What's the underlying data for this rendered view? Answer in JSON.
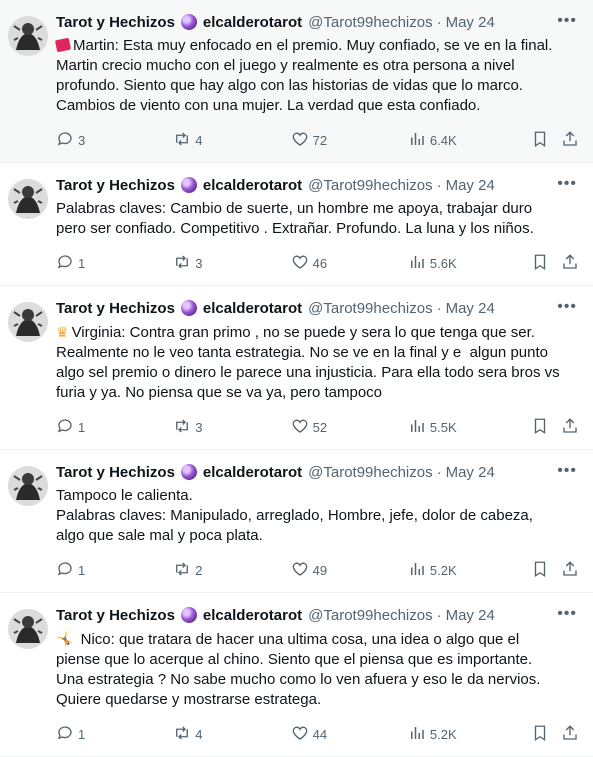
{
  "tweets": [
    {
      "display_name": "Tarot y Hechizos",
      "username": "elcalderotarot",
      "handle": "@Tarot99hechizos",
      "date": "May 24",
      "emoji": "ticket-icon",
      "text": "Martin: Esta muy enfocado en el premio. Muy confiado, se ve en la final.\nMartin crecio mucho con el juego y realmente es otra persona a nivel\nprofundo. Siento que hay algo con las historias de vidas que lo marco.\nCambios de viento con una mujer. La verdad que esta confiado.",
      "replies": "3",
      "retweets": "4",
      "likes": "72",
      "views": "6.4K"
    },
    {
      "display_name": "Tarot y Hechizos",
      "username": "elcalderotarot",
      "handle": "@Tarot99hechizos",
      "date": "May 24",
      "emoji": "",
      "text": "Palabras claves: Cambio de suerte, un hombre me apoya, trabajar duro\npero ser confiado. Competitivo . Extrañar. Profundo. La luna y los niños.",
      "replies": "1",
      "retweets": "3",
      "likes": "46",
      "views": "5.6K"
    },
    {
      "display_name": "Tarot y Hechizos",
      "username": "elcalderotarot",
      "handle": "@Tarot99hechizos",
      "date": "May 24",
      "emoji": "crown-icon",
      "text": "Virginia: Contra gran primo , no se puede y sera lo que tenga que ser.\nRealmente no le veo tanta estrategia. No se ve en la final y e  algun punto\nalgo sel premio o dinero le parece una injusticia. Para ella todo sera bros vs\nfuria y ya. No piensa que se va ya, pero tampoco",
      "replies": "1",
      "retweets": "3",
      "likes": "52",
      "views": "5.5K"
    },
    {
      "display_name": "Tarot y Hechizos",
      "username": "elcalderotarot",
      "handle": "@Tarot99hechizos",
      "date": "May 24",
      "emoji": "",
      "text": "Tampoco le calienta.\nPalabras claves: Manipulado, arreglado, Hombre, jefe, dolor de cabeza,\nalgo que sale mal y poca plata.",
      "replies": "1",
      "retweets": "2",
      "likes": "49",
      "views": "5.2K"
    },
    {
      "display_name": "Tarot y Hechizos",
      "username": "elcalderotarot",
      "handle": "@Tarot99hechizos",
      "date": "May 24",
      "emoji": "person-cartwheel-icon",
      "text": " Nico: que tratara de hacer una ultima cosa, una idea o algo que el\npiense que lo acerque al chino. Siento que el piensa que es importante.\nUna estrategia ? No sabe mucho como lo ven afuera y eso le da nervios.\nQuiere quedarse y mostrarse estratega.",
      "replies": "1",
      "retweets": "4",
      "likes": "44",
      "views": "5.2K"
    }
  ]
}
